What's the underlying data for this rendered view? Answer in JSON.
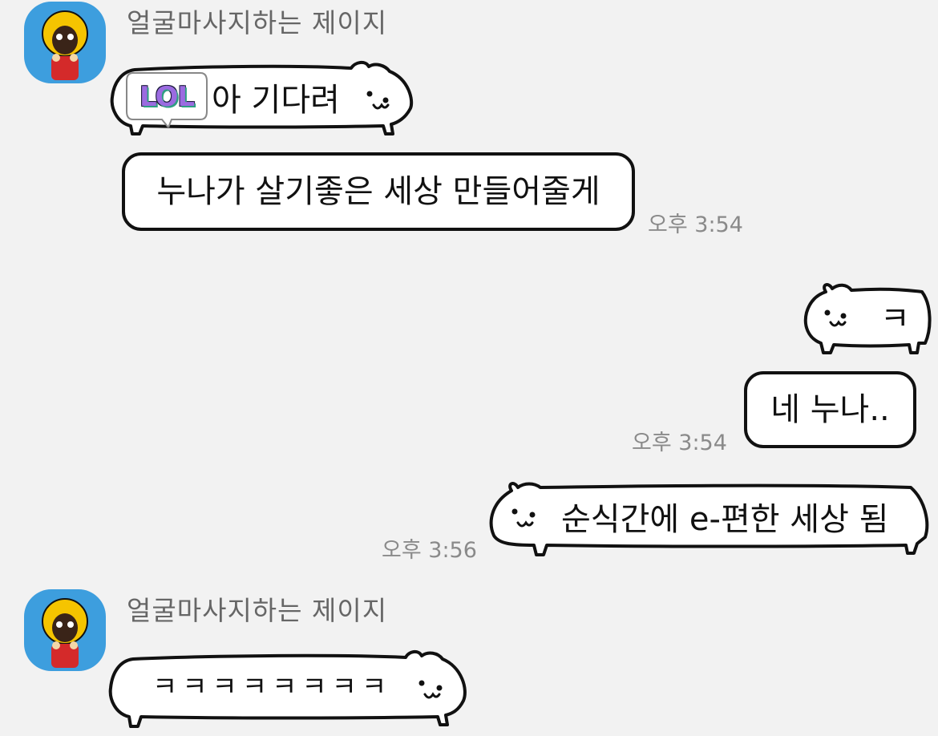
{
  "chat": {
    "messages": [
      {
        "type": "sender",
        "name": "얼굴마사지하는 제이지"
      },
      {
        "type": "emoticon",
        "badge": "LOL",
        "text": "아 기다려"
      },
      {
        "type": "text",
        "text": "누나가 살기좋은 세상 만들어줄게",
        "time": "오후 3:54"
      },
      {
        "type": "emoticon",
        "text": "ㅋ"
      },
      {
        "type": "text",
        "text": "네 누나..",
        "time": "오후 3:54"
      },
      {
        "type": "emoticon",
        "text": "순식간에 e-편한 세상 됨",
        "time": "오후 3:56"
      },
      {
        "type": "sender",
        "name": "얼굴마사지하는 제이지"
      },
      {
        "type": "emoticon",
        "text": "ㅋㅋㅋㅋㅋㅋㅋㅋ"
      }
    ]
  },
  "colors": {
    "background": "#f2f2f2",
    "avatar_bg": "#3d9ede",
    "bubble": "#ffffff",
    "outline": "#111111",
    "timestamp": "#8a8a8a",
    "sender_name": "#666666",
    "lol_fill": "#9b6be0",
    "lol_shadow": "#2f9e82"
  },
  "icons": [
    "avatar-character-icon",
    "bear-emoticon-icon"
  ]
}
